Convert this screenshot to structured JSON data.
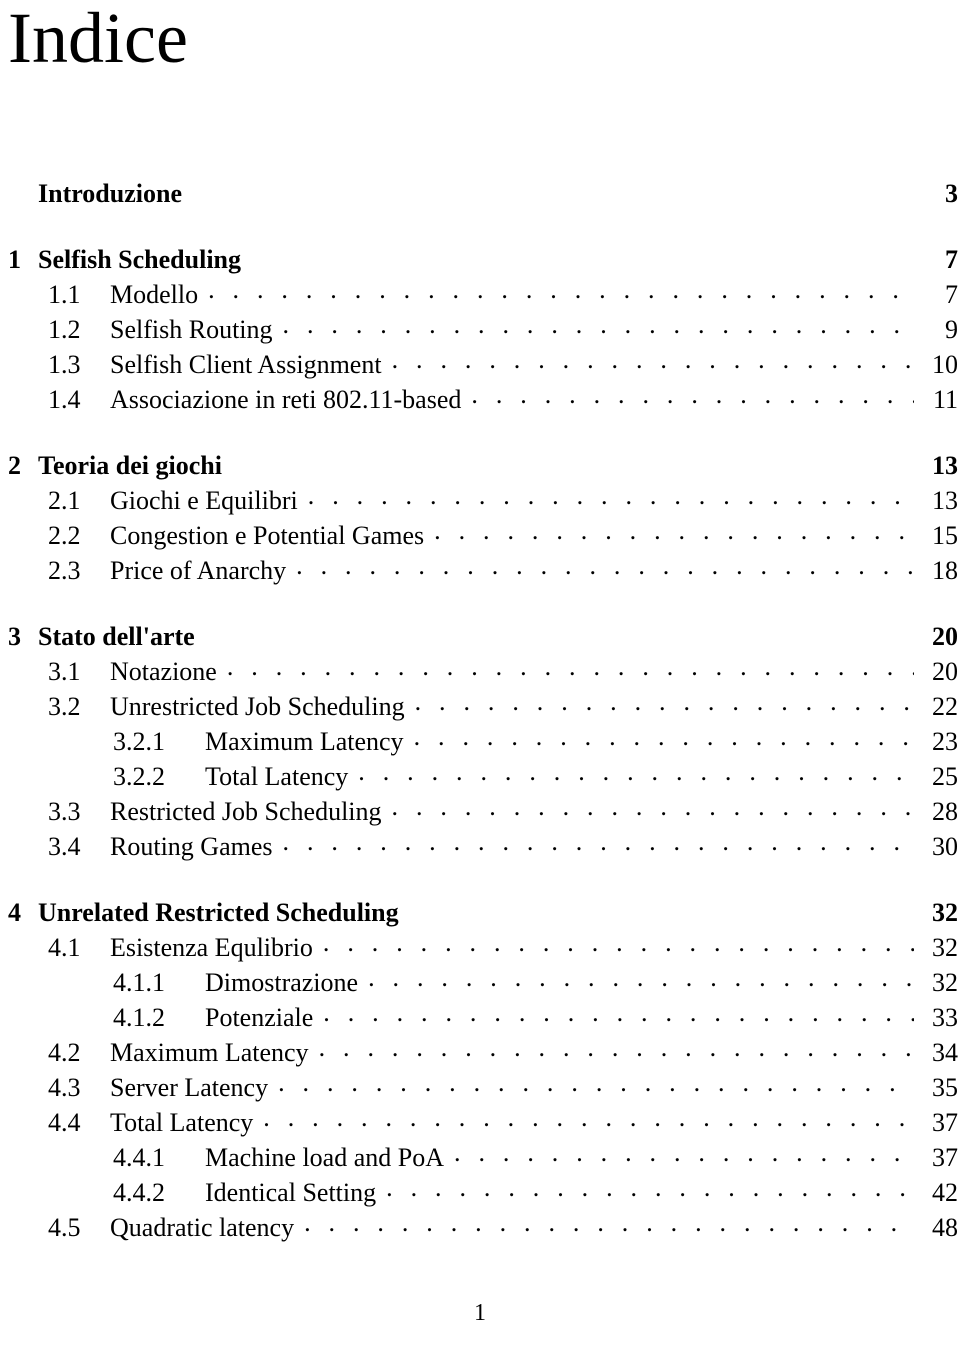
{
  "document": {
    "title": "Indice",
    "folio": "1"
  },
  "toc": {
    "entries": [
      {
        "level": 0,
        "number": "",
        "label": "Introduzione",
        "page": "3",
        "leader": false
      },
      {
        "level": 0,
        "number": "1",
        "label": "Selfish Scheduling",
        "page": "7",
        "leader": false
      },
      {
        "level": 1,
        "number": "1.1",
        "label": "Modello",
        "page": "7",
        "leader": true
      },
      {
        "level": 1,
        "number": "1.2",
        "label": "Selfish Routing",
        "page": "9",
        "leader": true
      },
      {
        "level": 1,
        "number": "1.3",
        "label": "Selfish Client Assignment",
        "page": "10",
        "leader": true
      },
      {
        "level": 1,
        "number": "1.4",
        "label": "Associazione in reti 802.11-based",
        "page": "11",
        "leader": true
      },
      {
        "level": 0,
        "number": "2",
        "label": "Teoria dei giochi",
        "page": "13",
        "leader": false
      },
      {
        "level": 1,
        "number": "2.1",
        "label": "Giochi e Equilibri",
        "page": "13",
        "leader": true
      },
      {
        "level": 1,
        "number": "2.2",
        "label": "Congestion e Potential Games",
        "page": "15",
        "leader": true
      },
      {
        "level": 1,
        "number": "2.3",
        "label": "Price of Anarchy",
        "page": "18",
        "leader": true
      },
      {
        "level": 0,
        "number": "3",
        "label": "Stato dell'arte",
        "page": "20",
        "leader": false
      },
      {
        "level": 1,
        "number": "3.1",
        "label": "Notazione",
        "page": "20",
        "leader": true
      },
      {
        "level": 1,
        "number": "3.2",
        "label": "Unrestricted Job Scheduling",
        "page": "22",
        "leader": true
      },
      {
        "level": 2,
        "number": "3.2.1",
        "label": "Maximum Latency",
        "page": "23",
        "leader": true
      },
      {
        "level": 2,
        "number": "3.2.2",
        "label": "Total Latency",
        "page": "25",
        "leader": true
      },
      {
        "level": 1,
        "number": "3.3",
        "label": "Restricted Job Scheduling",
        "page": "28",
        "leader": true
      },
      {
        "level": 1,
        "number": "3.4",
        "label": "Routing Games",
        "page": "30",
        "leader": true
      },
      {
        "level": 0,
        "number": "4",
        "label": "Unrelated Restricted Scheduling",
        "page": "32",
        "leader": false
      },
      {
        "level": 1,
        "number": "4.1",
        "label": "Esistenza Equlibrio",
        "page": "32",
        "leader": true
      },
      {
        "level": 2,
        "number": "4.1.1",
        "label": "Dimostrazione",
        "page": "32",
        "leader": true
      },
      {
        "level": 2,
        "number": "4.1.2",
        "label": "Potenziale",
        "page": "33",
        "leader": true
      },
      {
        "level": 1,
        "number": "4.2",
        "label": "Maximum Latency",
        "page": "34",
        "leader": true
      },
      {
        "level": 1,
        "number": "4.3",
        "label": "Server Latency",
        "page": "35",
        "leader": true
      },
      {
        "level": 1,
        "number": "4.4",
        "label": "Total Latency",
        "page": "37",
        "leader": true
      },
      {
        "level": 2,
        "number": "4.4.1",
        "label": "Machine load and PoA",
        "page": "37",
        "leader": true
      },
      {
        "level": 2,
        "number": "4.4.2",
        "label": "Identical Setting",
        "page": "42",
        "leader": true
      },
      {
        "level": 1,
        "number": "4.5",
        "label": "Quadratic latency",
        "page": "48",
        "leader": true
      }
    ]
  }
}
